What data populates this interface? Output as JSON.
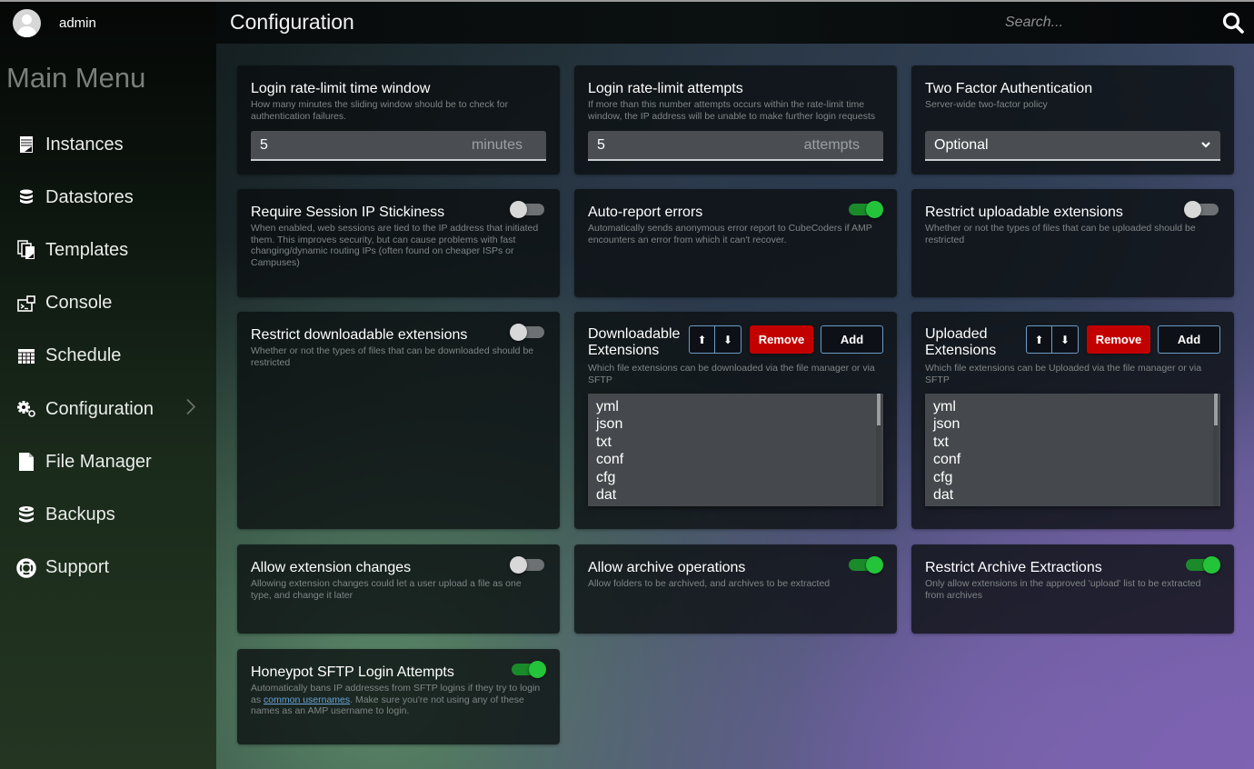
{
  "user": {
    "name": "admin",
    "avatar_icon": "user-avatar-icon"
  },
  "sidebar": {
    "title": "Main Menu",
    "items": [
      {
        "label": "Instances",
        "icon": "instances-icon"
      },
      {
        "label": "Datastores",
        "icon": "database-icon"
      },
      {
        "label": "Templates",
        "icon": "templates-icon"
      },
      {
        "label": "Console",
        "icon": "console-icon"
      },
      {
        "label": "Schedule",
        "icon": "schedule-icon"
      },
      {
        "label": "Configuration",
        "icon": "gears-icon",
        "has_submenu": true
      },
      {
        "label": "File Manager",
        "icon": "file-icon"
      },
      {
        "label": "Backups",
        "icon": "backups-icon"
      },
      {
        "label": "Support",
        "icon": "lifebuoy-icon"
      }
    ]
  },
  "header": {
    "title": "Configuration",
    "search_placeholder": "Search...",
    "search_icon": "search-icon"
  },
  "settings": {
    "rate_limit_window": {
      "title": "Login rate-limit time window",
      "description": "How many minutes the sliding window should be to check for authentication failures.",
      "value": "5",
      "unit": "minutes"
    },
    "rate_limit_attempts": {
      "title": "Login rate-limit attempts",
      "description": "If more than this number attempts occurs within the rate-limit time window, the IP address will be unable to make further login requests",
      "value": "5",
      "unit": "attempts"
    },
    "two_factor": {
      "title": "Two Factor Authentication",
      "description": "Server-wide two-factor policy",
      "selected": "Optional"
    },
    "session_ip_stickiness": {
      "title": "Require Session IP Stickiness",
      "description": "When enabled, web sessions are tied to the IP address that initiated them. This improves security, but can cause problems with fast changing/dynamic routing IPs (often found on cheaper ISPs or Campuses)",
      "enabled": false
    },
    "auto_report_errors": {
      "title": "Auto-report errors",
      "description": "Automatically sends anonymous error report to CubeCoders if AMP encounters an error from which it can't recover.",
      "enabled": true
    },
    "restrict_uploadable": {
      "title": "Restrict uploadable extensions",
      "description": "Whether or not the types of files that can be uploaded should be restricted",
      "enabled": false
    },
    "restrict_downloadable": {
      "title": "Restrict downloadable extensions",
      "description": "Whether or not the types of files that can be downloaded should be restricted",
      "enabled": false
    },
    "downloadable_extensions": {
      "title": "Downloadable Extensions",
      "description": "Which file extensions can be downloaded via the file manager or via SFTP",
      "up_label": "⬆",
      "down_label": "⬇",
      "remove_label": "Remove",
      "add_label": "Add",
      "items": [
        "yml",
        "json",
        "txt",
        "conf",
        "cfg",
        "dat"
      ]
    },
    "uploaded_extensions": {
      "title": "Uploaded Extensions",
      "description": "Which file extensions can be Uploaded via the file manager or via SFTP",
      "up_label": "⬆",
      "down_label": "⬇",
      "remove_label": "Remove",
      "add_label": "Add",
      "items": [
        "yml",
        "json",
        "txt",
        "conf",
        "cfg",
        "dat"
      ]
    },
    "allow_extension_changes": {
      "title": "Allow extension changes",
      "description": "Allowing extension changes could let a user upload a file as one type, and change it later",
      "enabled": false
    },
    "allow_archive_operations": {
      "title": "Allow archive operations",
      "description": "Allow folders to be archived, and archives to be extracted",
      "enabled": true
    },
    "restrict_archive_extractions": {
      "title": "Restrict Archive Extractions",
      "description": "Only allow extensions in the approved 'upload' list to be extracted from archives",
      "enabled": true
    },
    "honeypot_sftp": {
      "title": "Honeypot SFTP Login Attempts",
      "description_before": "Automatically bans IP addresses from SFTP logins if they try to login as ",
      "link_text": "common usernames",
      "description_after": ". Make sure you're not using any of these names as an AMP username to login.",
      "enabled": true
    }
  },
  "colors": {
    "toggle_on": "#24c43a",
    "toggle_off": "#d8d8d8",
    "remove_button": "#c30000",
    "outline_button_border": "#6b9cc7",
    "link": "#6aa4d6"
  }
}
